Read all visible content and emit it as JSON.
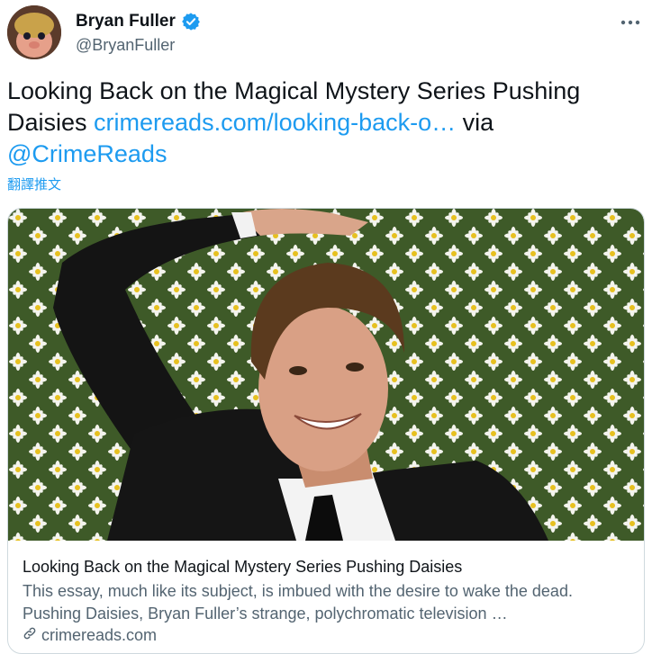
{
  "author": {
    "name": "Bryan Fuller",
    "handle": "@BryanFuller",
    "avatar_icon": "muppet-avatar",
    "verified_icon": "verified-badge-icon"
  },
  "menu": {
    "more_icon": "more-horizontal-icon"
  },
  "tweet": {
    "text_before": "Looking Back on the Magical Mystery Series Pushing Daisies ",
    "link": "crimereads.com/looking-back-o…",
    "text_via": " via ",
    "mention": "@CrimeReads",
    "translate_label": "翻譯推文"
  },
  "card": {
    "image_alt_icon": "daisy-field-photo",
    "title": "Looking Back on the Magical Mystery Series Pushing Daisies",
    "description": "This essay, much like its subject, is imbued with the desire to wake the dead. Pushing Daisies, Bryan Fuller’s strange, polychromatic television …",
    "domain": "crimereads.com",
    "link_icon": "link-icon"
  },
  "colors": {
    "accent": "#1d9bf0",
    "text": "#0f1419",
    "secondary": "#536471",
    "border": "#cfd9de"
  }
}
